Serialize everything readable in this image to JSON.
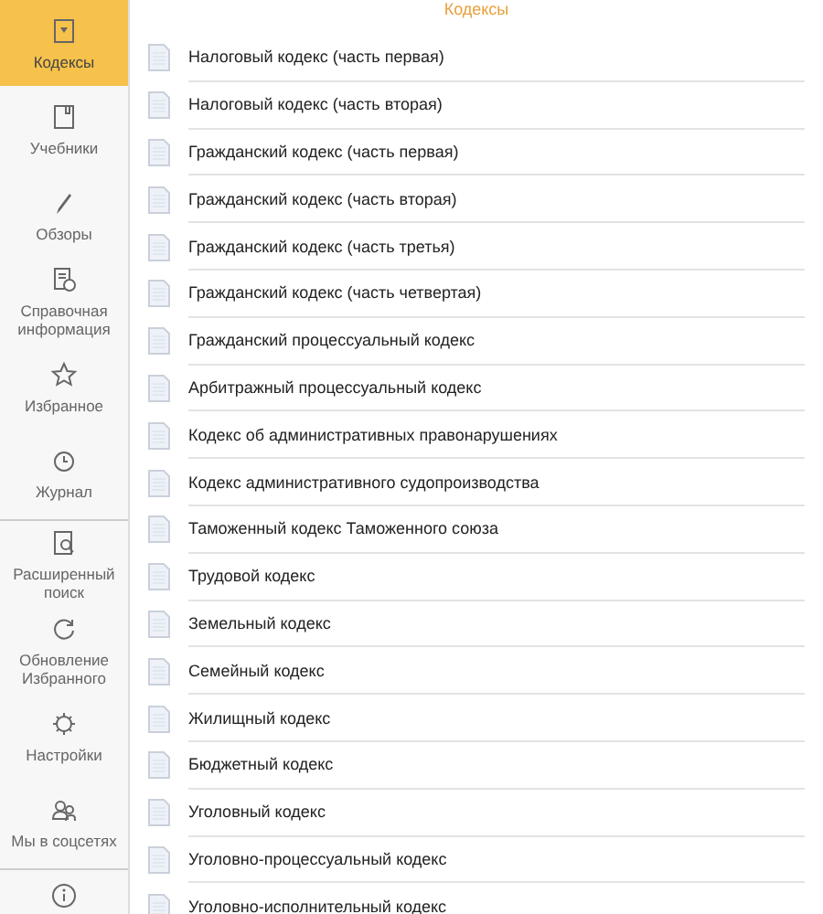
{
  "header": {
    "title": "Кодексы"
  },
  "sidebar": {
    "groups": [
      [
        {
          "label": "Кодексы",
          "selected": true
        },
        {
          "label": "Учебники",
          "selected": false
        },
        {
          "label": "Обзоры",
          "selected": false
        },
        {
          "label": "Справочная информация",
          "selected": false
        },
        {
          "label": "Избранное",
          "selected": false
        },
        {
          "label": "Журнал",
          "selected": false
        }
      ],
      [
        {
          "label": "Расширенный поиск",
          "selected": false
        },
        {
          "label": "Обновление Избранного",
          "selected": false
        },
        {
          "label": "Настройки",
          "selected": false
        },
        {
          "label": "Мы в соцсетях",
          "selected": false
        }
      ]
    ]
  },
  "documents": [
    "Налоговый кодекс (часть первая)",
    "Налоговый кодекс (часть вторая)",
    "Гражданский кодекс (часть первая)",
    "Гражданский кодекс (часть вторая)",
    "Гражданский кодекс (часть третья)",
    "Гражданский кодекс (часть четвертая)",
    "Гражданский процессуальный кодекс",
    "Арбитражный процессуальный кодекс",
    "Кодекс об административных правонарушениях",
    "Кодекс административного судопроизводства",
    "Таможенный кодекс Таможенного союза",
    "Трудовой кодекс",
    "Земельный кодекс",
    "Семейный кодекс",
    "Жилищный кодекс",
    "Бюджетный кодекс",
    "Уголовный кодекс",
    "Уголовно-процессуальный кодекс",
    "Уголовно-исполнительный кодекс"
  ]
}
